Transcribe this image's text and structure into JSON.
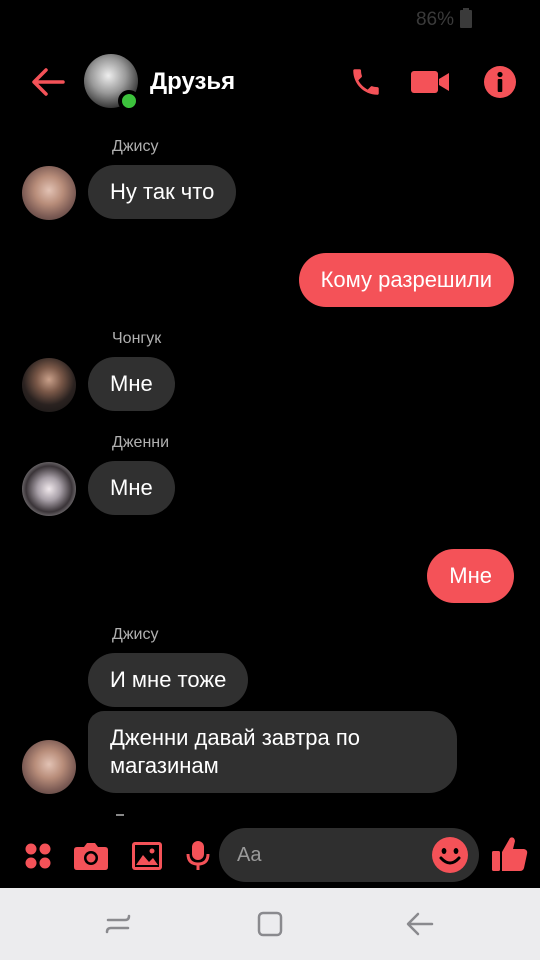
{
  "status_bar": {
    "battery": "86%"
  },
  "header": {
    "title": "Друзья"
  },
  "messages": [
    {
      "sender": "Джису",
      "text": "Ну так что"
    },
    {
      "text": "Кому разрешили"
    },
    {
      "sender": "Чонгук",
      "text": "Мне"
    },
    {
      "sender": "Дженни",
      "text": "Мне"
    },
    {
      "text": "Мне"
    },
    {
      "sender": "Джису",
      "text": "И мне тоже"
    },
    {
      "text": "Дженни давай завтра по магазинам"
    }
  ],
  "composer": {
    "placeholder": "Aa"
  },
  "colors": {
    "accent": "#f45258",
    "incoming_bubble": "#303030",
    "online": "#3cc23c",
    "background": "#000000"
  },
  "icons": [
    "back-arrow-icon",
    "phone-icon",
    "video-icon",
    "info-icon",
    "apps-grid-icon",
    "camera-icon",
    "image-icon",
    "microphone-icon",
    "emoji-icon",
    "thumbs-up-icon",
    "recent-apps-icon",
    "home-icon",
    "nav-back-icon"
  ]
}
